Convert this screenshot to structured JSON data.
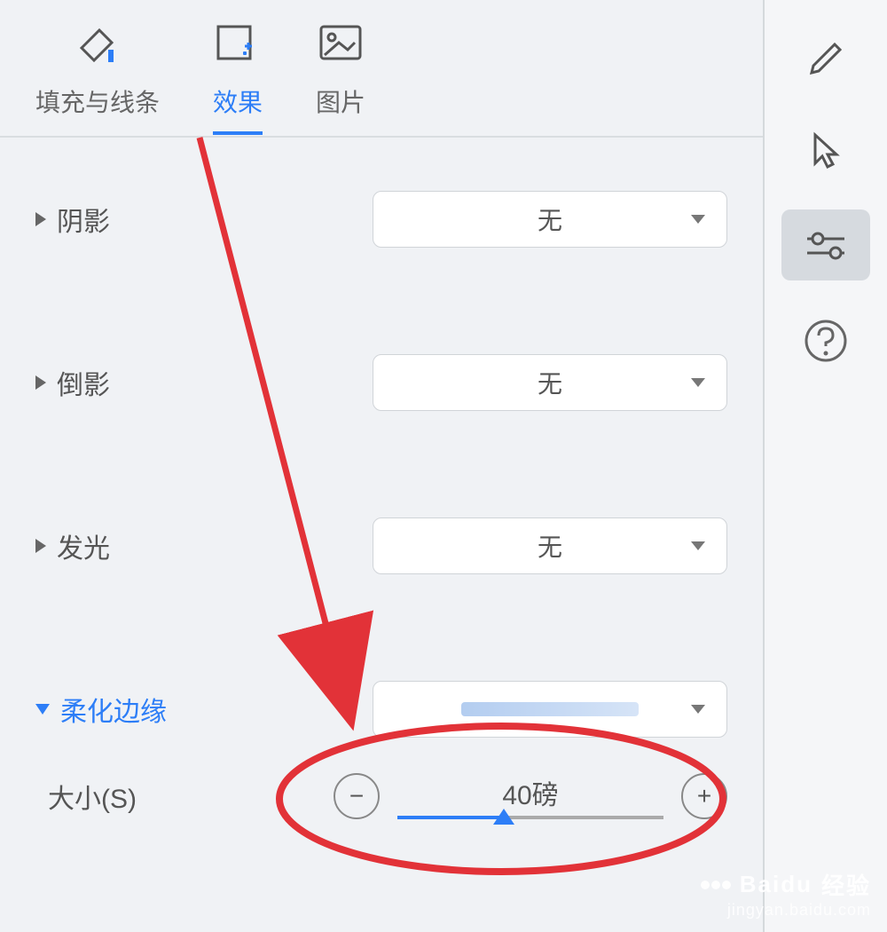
{
  "tabs": [
    {
      "label": "填充与线条"
    },
    {
      "label": "效果"
    },
    {
      "label": "图片"
    }
  ],
  "sections": {
    "shadow": {
      "label": "阴影",
      "value": "无"
    },
    "reflection": {
      "label": "倒影",
      "value": "无"
    },
    "glow": {
      "label": "发光",
      "value": "无"
    },
    "softEdges": {
      "label": "柔化边缘"
    }
  },
  "slider": {
    "label": "大小(S)",
    "value": "40磅",
    "minus": "−",
    "plus": "+"
  },
  "colors": {
    "accent": "#2d7ef7",
    "annotation": "#e23238"
  },
  "watermark": {
    "brand": "Baidu",
    "sub": "经验",
    "url": "jingyan.baidu.com"
  }
}
